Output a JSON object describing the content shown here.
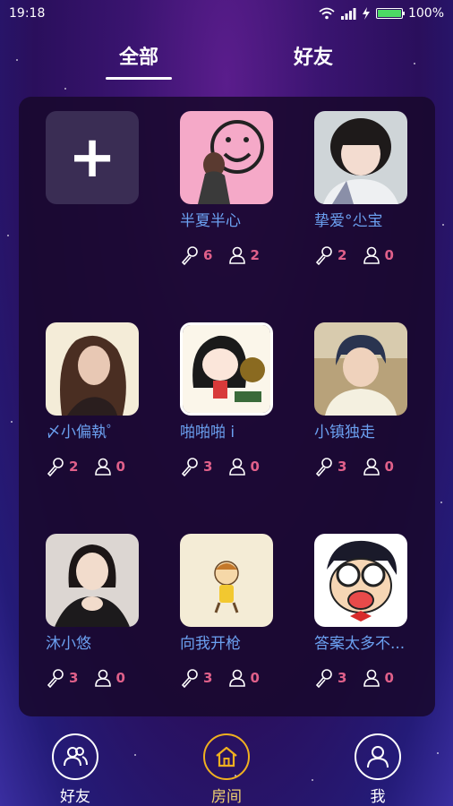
{
  "status": {
    "time": "19:18",
    "battery": "100%"
  },
  "tabs": [
    {
      "label": "全部",
      "active": true
    },
    {
      "label": "好友",
      "active": false
    }
  ],
  "add_label": "+",
  "rooms": [
    {
      "name": "半夏半心",
      "mics": "6",
      "people": "2"
    },
    {
      "name": "挚爱°尐宝",
      "mics": "2",
      "people": "0"
    },
    {
      "name": "〆小偏執゜",
      "mics": "2",
      "people": "0"
    },
    {
      "name": "啪啪啪 i",
      "mics": "3",
      "people": "0"
    },
    {
      "name": "小镇独走",
      "mics": "3",
      "people": "0"
    },
    {
      "name": "沐小悠",
      "mics": "3",
      "people": "0"
    },
    {
      "name": "向我开枪",
      "mics": "3",
      "people": "0"
    },
    {
      "name": "答案太多不...",
      "mics": "3",
      "people": "0"
    }
  ],
  "nav": [
    {
      "label": "好友",
      "icon": "friends-icon"
    },
    {
      "label": "房间",
      "icon": "home-icon",
      "active": true
    },
    {
      "label": "我",
      "icon": "user-icon"
    }
  ],
  "colors": {
    "accent": "#f0b020",
    "name": "#6ba0f0",
    "count": "#e0608a"
  }
}
